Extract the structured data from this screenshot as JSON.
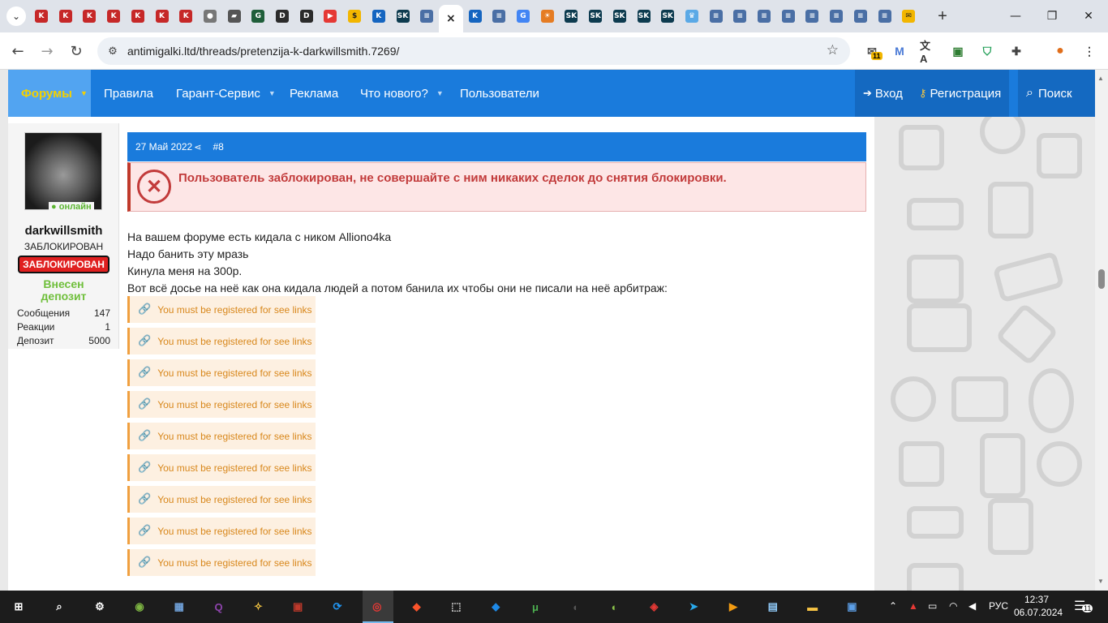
{
  "browser": {
    "tabs_dropdown_icon": "chevron-down-icon",
    "tab_favicons": [
      {
        "icon": "k-icon",
        "color": "#c62828",
        "glyph": "K"
      },
      {
        "icon": "k-icon",
        "color": "#c62828",
        "glyph": "K"
      },
      {
        "icon": "k-icon",
        "color": "#c62828",
        "glyph": "K"
      },
      {
        "icon": "k-icon",
        "color": "#c62828",
        "glyph": "K"
      },
      {
        "icon": "k-icon",
        "color": "#c62828",
        "glyph": "K"
      },
      {
        "icon": "k-icon",
        "color": "#c62828",
        "glyph": "K"
      },
      {
        "icon": "k-icon",
        "color": "#c62828",
        "glyph": "K"
      },
      {
        "icon": "globe-icon",
        "color": "#777777",
        "glyph": "●"
      },
      {
        "icon": "gamepad-icon",
        "color": "#555555",
        "glyph": "▰"
      },
      {
        "icon": "gs-icon",
        "color": "#1f5e3a",
        "glyph": "G"
      },
      {
        "icon": "dm-icon",
        "color": "#2b2b2b",
        "glyph": "D"
      },
      {
        "icon": "dm-icon",
        "color": "#2b2b2b",
        "glyph": "D"
      },
      {
        "icon": "youtube-icon",
        "color": "#e53935",
        "glyph": "▶"
      },
      {
        "icon": "coin-icon",
        "color": "#f2b600",
        "glyph": "$"
      },
      {
        "icon": "k-flag-icon",
        "color": "#1565c0",
        "glyph": "K"
      },
      {
        "icon": "sk-icon",
        "color": "#0d3b4f",
        "glyph": "SK"
      },
      {
        "icon": "forum-icon",
        "color": "#4a6fa5",
        "glyph": "≡"
      },
      {
        "icon": "close-icon",
        "color": "#ffffff",
        "glyph": "×",
        "active": true
      },
      {
        "icon": "k-flag-icon",
        "color": "#1565c0",
        "glyph": "K"
      },
      {
        "icon": "forum-icon",
        "color": "#4a6fa5",
        "glyph": "≡"
      },
      {
        "icon": "google-icon",
        "color": "#4285f4",
        "glyph": "G"
      },
      {
        "icon": "sun-icon",
        "color": "#e57c23",
        "glyph": "☀"
      },
      {
        "icon": "sk-icon",
        "color": "#0d3b4f",
        "glyph": "SK"
      },
      {
        "icon": "sk-icon",
        "color": "#0d3b4f",
        "glyph": "SK"
      },
      {
        "icon": "sk-icon",
        "color": "#0d3b4f",
        "glyph": "SK"
      },
      {
        "icon": "sk-icon",
        "color": "#0d3b4f",
        "glyph": "SK"
      },
      {
        "icon": "sk-icon",
        "color": "#0d3b4f",
        "glyph": "SK"
      },
      {
        "icon": "crown-icon",
        "color": "#5aa9e6",
        "glyph": "♛"
      },
      {
        "icon": "forum-icon",
        "color": "#4a6fa5",
        "glyph": "≡"
      },
      {
        "icon": "forum-icon",
        "color": "#4a6fa5",
        "glyph": "≡"
      },
      {
        "icon": "forum-icon",
        "color": "#4a6fa5",
        "glyph": "≡"
      },
      {
        "icon": "forum-icon",
        "color": "#4a6fa5",
        "glyph": "≡"
      },
      {
        "icon": "forum-icon",
        "color": "#4a6fa5",
        "glyph": "≡"
      },
      {
        "icon": "forum-icon",
        "color": "#4a6fa5",
        "glyph": "≡"
      },
      {
        "icon": "forum-icon",
        "color": "#4a6fa5",
        "glyph": "≡"
      },
      {
        "icon": "forum-icon",
        "color": "#4a6fa5",
        "glyph": "≡"
      },
      {
        "icon": "mail-icon",
        "color": "#f2b600",
        "glyph": "✉"
      }
    ],
    "new_tab_icon": "plus-icon",
    "window_controls": [
      "minimize-icon",
      "restore-icon",
      "close-icon"
    ],
    "url": "antimigalki.ltd/threads/pretenzija-k-darkwillsmith.7269/",
    "extensions": [
      {
        "icon": "mail-counter-icon",
        "badge": "11"
      },
      {
        "icon": "gmail-icon"
      },
      {
        "icon": "translate-icon"
      },
      {
        "icon": "extension-green-icon"
      },
      {
        "icon": "shield-icon"
      },
      {
        "icon": "puzzle-icon"
      },
      {
        "icon": "profile-avatar-icon"
      },
      {
        "icon": "menu-icon"
      }
    ]
  },
  "forum_nav": {
    "items": [
      {
        "label": "Форумы",
        "selected": true,
        "dropdown": true
      },
      {
        "label": "Правила"
      },
      {
        "label": "Гарант-Сервис",
        "dropdown": true
      },
      {
        "label": "Реклама"
      },
      {
        "label": "Что нового?",
        "dropdown": true
      },
      {
        "label": "Пользователи"
      }
    ],
    "login": "Вход",
    "register": "Регистрация",
    "search": "Поиск"
  },
  "post": {
    "user": {
      "online": "онлайн",
      "name": "darkwillsmith",
      "status": "ЗАБЛОКИРОВАН",
      "badge": "ЗАБЛОКИРОВАН",
      "deposit_line1": "Внесен",
      "deposit_line2": "депозит",
      "stats": [
        {
          "label": "Сообщения",
          "value": "147"
        },
        {
          "label": "Реакции",
          "value": "1"
        },
        {
          "label": "Депозит",
          "value": "5000"
        }
      ]
    },
    "date": "27 Май 2022",
    "number": "#8",
    "ban_message": "Пользователь заблокирован, не совершайте с ним никаких сделок до снятия блокировки.",
    "lines": [
      "На вашем форуме есть кидала с ником Alliono4ka",
      "Надо банить эту мразь",
      "Кинула меня на 300р.",
      "Вот всё досье на неё как она кидала людей а потом банила их чтобы они не писали на неё арбитраж:"
    ],
    "link_placeholder": "You must be registered for see links",
    "link_count": 9
  },
  "taskbar": {
    "apps": [
      {
        "icon": "windows-start-icon",
        "color": "#ffffff"
      },
      {
        "icon": "search-icon",
        "color": "#ffffff"
      },
      {
        "icon": "settings-gear-icon",
        "color": "#ffffff"
      },
      {
        "icon": "colorful-orb-icon",
        "color": "#7cb342"
      },
      {
        "icon": "image-viewer-icon",
        "color": "#6fa0d8"
      },
      {
        "icon": "q-app-icon",
        "color": "#8e44ad"
      },
      {
        "icon": "python-icon",
        "color": "#f4c542"
      },
      {
        "icon": "winrar-icon",
        "color": "#c0392b"
      },
      {
        "icon": "sync-icon",
        "color": "#2196f3"
      },
      {
        "icon": "chrome-icon",
        "color": "#e53935"
      },
      {
        "icon": "brave-icon",
        "color": "#fb542b"
      },
      {
        "icon": "screen-capture-icon",
        "color": "#dddddd"
      },
      {
        "icon": "diamond-arrow-icon",
        "color": "#1e88e5"
      },
      {
        "icon": "utorrent-icon",
        "color": "#4caf50"
      },
      {
        "icon": "audio-icon",
        "color": "#555555"
      },
      {
        "icon": "fruit-icon",
        "color": "#8bc34a"
      },
      {
        "icon": "game-icon",
        "color": "#e53935"
      },
      {
        "icon": "telegram-icon",
        "color": "#29a9eb"
      },
      {
        "icon": "media-player-icon",
        "color": "#f39c12"
      },
      {
        "icon": "notepad-icon",
        "color": "#90caf9"
      },
      {
        "icon": "folder-icon",
        "color": "#f6c344"
      },
      {
        "icon": "photo-app-icon",
        "color": "#5c9ee6"
      }
    ],
    "tray_lang": "РУС",
    "time": "12:37",
    "date": "06.07.2024",
    "notifications": "11"
  }
}
